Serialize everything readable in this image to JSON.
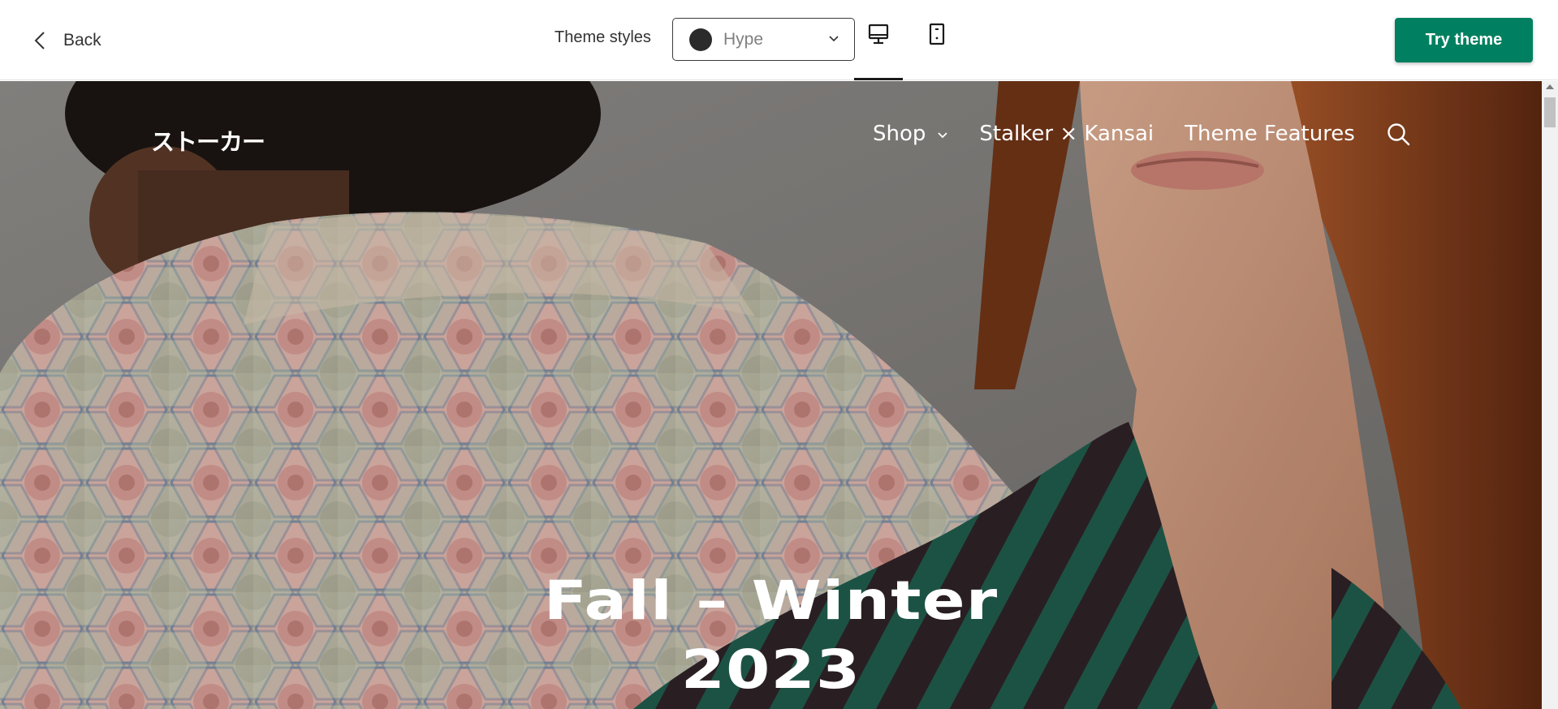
{
  "toolbar": {
    "back_label": "Back",
    "styles_label": "Theme styles",
    "style_select": {
      "value": "Hype",
      "swatch_color": "#2b2b2b"
    },
    "views": [
      {
        "name": "desktop",
        "icon": "desktop-icon",
        "selected": true
      },
      {
        "name": "mobile",
        "icon": "mobile-icon",
        "selected": false
      }
    ],
    "try_label": "Try theme",
    "accent_color": "#008060"
  },
  "store": {
    "logo": "ストーカー",
    "nav": {
      "shop": "Shop",
      "collab": "Stalker × Kansai",
      "features": "Theme Features"
    },
    "hero": {
      "title_line1": "Fall – Winter",
      "title_line2": "2023"
    }
  }
}
